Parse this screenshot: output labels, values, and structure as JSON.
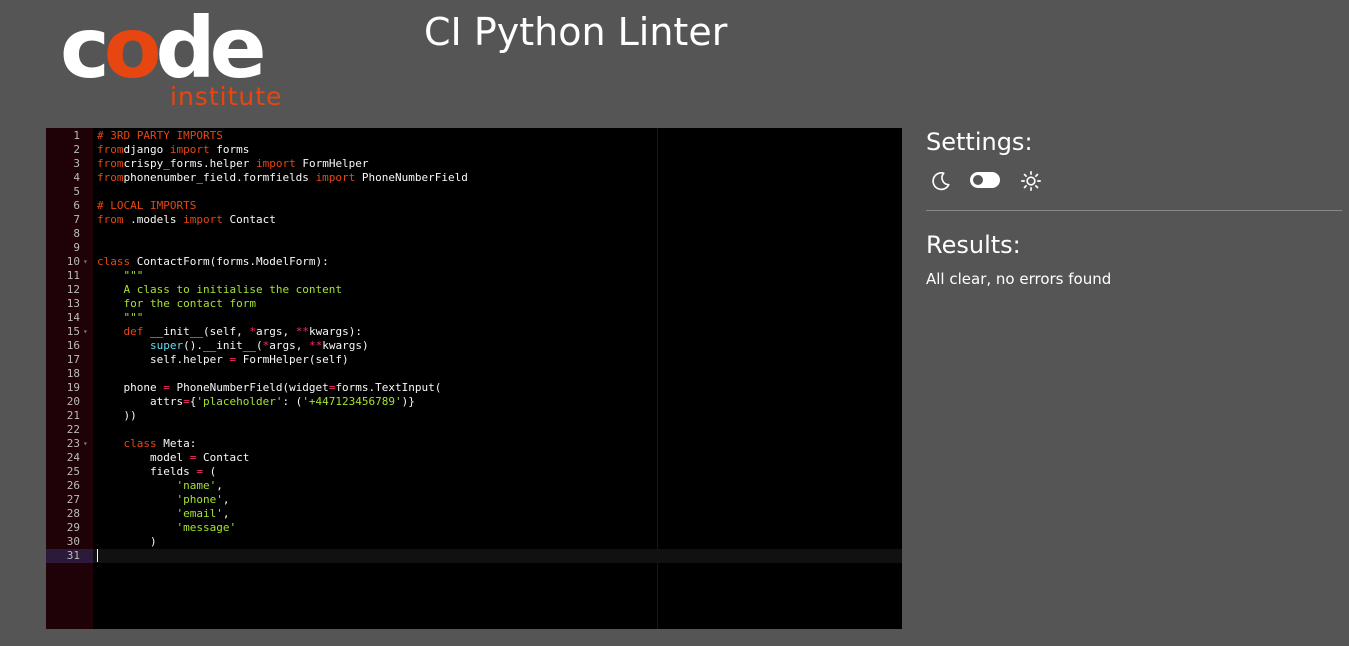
{
  "header": {
    "logo_code_c": "c",
    "logo_code_o": "o",
    "logo_code_de": "de",
    "logo_sub": "institute",
    "title": "CI Python Linter"
  },
  "settings": {
    "title": "Settings:",
    "icons": [
      "moon-icon",
      "toggle-switch",
      "sun-icon"
    ]
  },
  "results": {
    "title": "Results:",
    "message": "All clear, no errors found"
  },
  "colors": {
    "background": "#555555",
    "brand_orange": "#e84610",
    "editor_bg": "#000000",
    "gutter_bg": "#1e0208"
  },
  "editor": {
    "line_numbers": [
      "1",
      "2",
      "3",
      "4",
      "5",
      "6",
      "7",
      "8",
      "9",
      "10",
      "11",
      "12",
      "13",
      "14",
      "15",
      "16",
      "17",
      "18",
      "19",
      "20",
      "21",
      "22",
      "23",
      "24",
      "25",
      "26",
      "27",
      "28",
      "29",
      "30",
      "31"
    ],
    "lines": [
      [
        [
          "cm",
          "# 3RD PARTY IMPORTS"
        ]
      ],
      [
        [
          "kw",
          "from"
        ],
        [
          "",
          "django "
        ],
        [
          "kw",
          "import"
        ],
        [
          "",
          " forms"
        ]
      ],
      [
        [
          "kw",
          "from"
        ],
        [
          "",
          "crispy_forms.helper "
        ],
        [
          "kw",
          "import"
        ],
        [
          "",
          " FormHelper"
        ]
      ],
      [
        [
          "kw",
          "from"
        ],
        [
          "",
          "phonenumber_field.formfields "
        ],
        [
          "kw",
          "import"
        ],
        [
          "",
          " PhoneNumberField"
        ]
      ],
      [],
      [
        [
          "cm",
          "# LOCAL IMPORTS"
        ]
      ],
      [
        [
          "kw",
          "from"
        ],
        [
          "",
          " .models "
        ],
        [
          "kw",
          "import"
        ],
        [
          "",
          " Contact"
        ]
      ],
      [],
      [],
      [
        [
          "kw",
          "class"
        ],
        [
          "",
          " ContactForm(forms.ModelForm):"
        ]
      ],
      [
        [
          "",
          "    "
        ],
        [
          "st",
          "\"\"\""
        ]
      ],
      [
        [
          "",
          "    "
        ],
        [
          "st",
          "A class to initialise the content"
        ]
      ],
      [
        [
          "",
          "    "
        ],
        [
          "st",
          "for the contact form"
        ]
      ],
      [
        [
          "",
          "    "
        ],
        [
          "st",
          "\"\"\""
        ]
      ],
      [
        [
          "",
          "    "
        ],
        [
          "kw",
          "def"
        ],
        [
          "",
          " __init__(self, "
        ],
        [
          "op",
          "*"
        ],
        [
          "",
          "args, "
        ],
        [
          "op",
          "**"
        ],
        [
          "",
          "kwargs):"
        ]
      ],
      [
        [
          "",
          "        "
        ],
        [
          "bi",
          "super"
        ],
        [
          "",
          "().__init__("
        ],
        [
          "op",
          "*"
        ],
        [
          "",
          "args, "
        ],
        [
          "op",
          "**"
        ],
        [
          "",
          "kwargs)"
        ]
      ],
      [
        [
          "",
          "        self.helper "
        ],
        [
          "op",
          "="
        ],
        [
          "",
          " FormHelper(self)"
        ]
      ],
      [],
      [
        [
          "",
          "    phone "
        ],
        [
          "op",
          "="
        ],
        [
          "",
          " PhoneNumberField(widget"
        ],
        [
          "op",
          "="
        ],
        [
          "",
          "forms.TextInput("
        ]
      ],
      [
        [
          "",
          "        attrs"
        ],
        [
          "op",
          "="
        ],
        [
          "",
          "{"
        ],
        [
          "st",
          "'placeholder'"
        ],
        [
          "",
          ": ("
        ],
        [
          "st",
          "'+447123456789'"
        ],
        [
          "",
          ")}"
        ]
      ],
      [
        [
          "",
          "    ))"
        ]
      ],
      [],
      [
        [
          "",
          "    "
        ],
        [
          "kw",
          "class"
        ],
        [
          "",
          " Meta:"
        ]
      ],
      [
        [
          "",
          "        model "
        ],
        [
          "op",
          "="
        ],
        [
          "",
          " Contact"
        ]
      ],
      [
        [
          "",
          "        fields "
        ],
        [
          "op",
          "="
        ],
        [
          "",
          " ("
        ]
      ],
      [
        [
          "",
          "            "
        ],
        [
          "st",
          "'name'"
        ],
        [
          "",
          ","
        ]
      ],
      [
        [
          "",
          "            "
        ],
        [
          "st",
          "'phone'"
        ],
        [
          "",
          ","
        ]
      ],
      [
        [
          "",
          "            "
        ],
        [
          "st",
          "'email'"
        ],
        [
          "",
          ","
        ]
      ],
      [
        [
          "",
          "            "
        ],
        [
          "st",
          "'message'"
        ]
      ],
      [
        [
          "",
          "        )"
        ]
      ],
      []
    ],
    "fold_lines": [
      10,
      15,
      23
    ],
    "active_line": 31
  }
}
